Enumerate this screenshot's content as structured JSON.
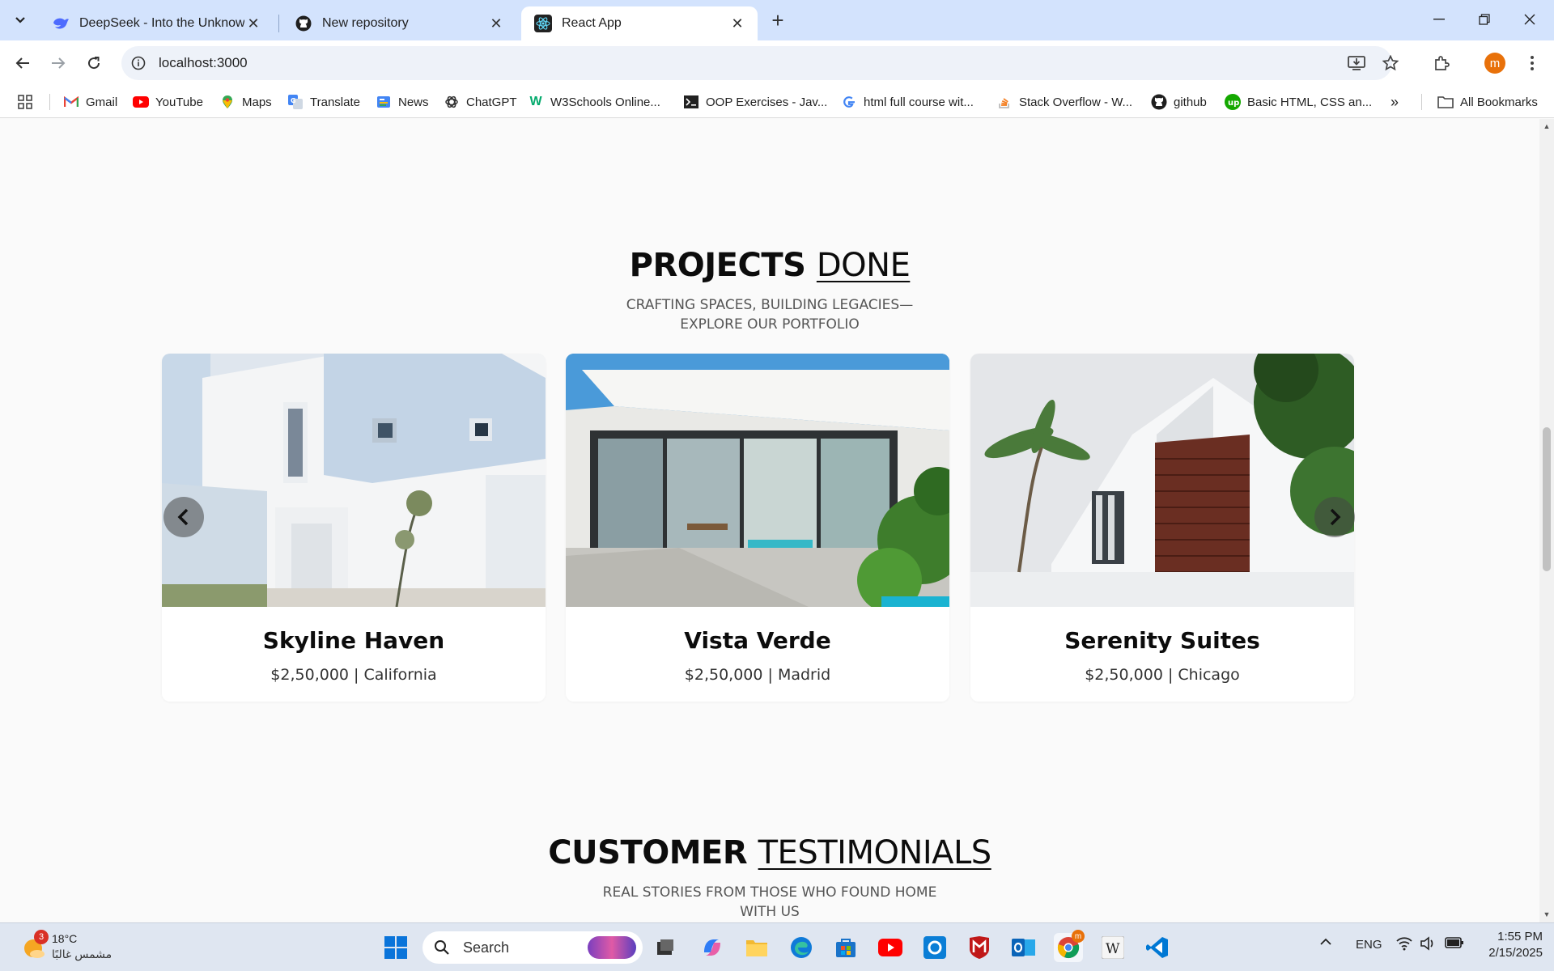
{
  "browser": {
    "tabs": [
      {
        "title": "DeepSeek - Into the Unknown",
        "icon": "deepseek-icon"
      },
      {
        "title": "New repository",
        "icon": "github-icon"
      },
      {
        "title": "React App",
        "icon": "react-icon",
        "active": true
      }
    ],
    "address": "localhost:3000",
    "profile_initial": "m",
    "bookmarks": [
      {
        "label": "Gmail",
        "icon": "gmail-icon"
      },
      {
        "label": "YouTube",
        "icon": "youtube-icon"
      },
      {
        "label": "Maps",
        "icon": "maps-icon"
      },
      {
        "label": "Translate",
        "icon": "translate-icon"
      },
      {
        "label": "News",
        "icon": "news-icon"
      },
      {
        "label": "ChatGPT",
        "icon": "chatgpt-icon"
      },
      {
        "label": "W3Schools Online...",
        "icon": "w3schools-icon"
      },
      {
        "label": "OOP Exercises - Jav...",
        "icon": "terminal-icon"
      },
      {
        "label": "html full course wit...",
        "icon": "google-icon"
      },
      {
        "label": "Stack Overflow - W...",
        "icon": "stackoverflow-icon"
      },
      {
        "label": "github",
        "icon": "github-icon"
      },
      {
        "label": "Basic HTML, CSS an...",
        "icon": "upwork-icon"
      }
    ],
    "all_bookmarks": "All Bookmarks"
  },
  "projects": {
    "title_bold": "PROJECTS",
    "title_underlined": "DONE",
    "subtitle": "CRAFTING SPACES, BUILDING LEGACIES—EXPLORE OUR PORTFOLIO",
    "cards": [
      {
        "name": "Skyline Haven",
        "meta": "$2,50,000 | California"
      },
      {
        "name": "Vista Verde",
        "meta": "$2,50,000 | Madrid"
      },
      {
        "name": "Serenity Suites",
        "meta": "$2,50,000 | Chicago"
      }
    ]
  },
  "testimonials": {
    "title_bold": "CUSTOMER",
    "title_underlined": "TESTIMONIALS",
    "subtitle": "REAL STORIES FROM THOSE WHO FOUND HOME WITH US"
  },
  "taskbar": {
    "weather_temp": "18°C",
    "weather_desc": "مشمس غالبًا",
    "weather_badge": "3",
    "search_placeholder": "Search",
    "language": "ENG",
    "time": "1:55 PM",
    "date": "2/15/2025"
  },
  "colors": {
    "tabbar": "#d3e3fd",
    "page_bg": "#fafafa",
    "title_text": "#0c0c0c"
  }
}
